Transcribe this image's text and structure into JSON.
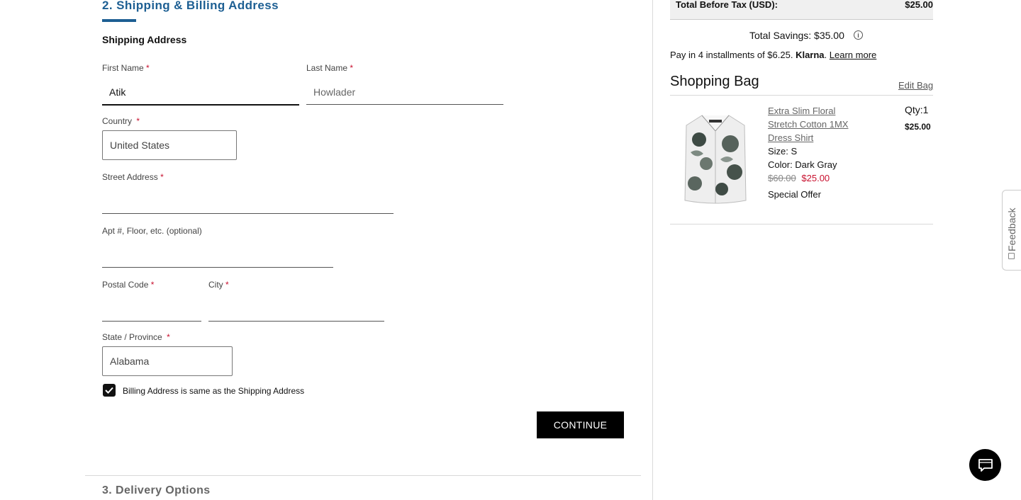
{
  "checkout": {
    "section_title": "2. Shipping & Billing Address",
    "shipping_subtitle": "Shipping Address",
    "next_section_title": "3. Delivery Options",
    "continue_label": "CONTINUE",
    "required_mark": "*"
  },
  "form": {
    "first_name": {
      "label": "First Name",
      "value": "Atik"
    },
    "last_name": {
      "label": "Last Name",
      "placeholder": "Howlader"
    },
    "country": {
      "label": "Country",
      "selected": "United States"
    },
    "street": {
      "label": "Street Address",
      "value": ""
    },
    "apt": {
      "label": "Apt #, Floor, etc. (optional)",
      "value": ""
    },
    "postal": {
      "label": "Postal Code",
      "value": ""
    },
    "city": {
      "label": "City",
      "value": ""
    },
    "state": {
      "label": "State / Province",
      "selected": "Alabama"
    },
    "billing_same": {
      "label": "Billing Address is same as the Shipping Address",
      "checked": true
    }
  },
  "summary": {
    "total_before_tax_label": "Total Before Tax (USD):",
    "total_before_tax_value": "$25.00",
    "total_savings": "Total Savings: $35.00",
    "klarna_prefix": "Pay in 4 installments of $6.25.",
    "klarna_brand": "Klarna",
    "klarna_suffix": ".",
    "learn_more": "Learn more"
  },
  "bag": {
    "title": "Shopping Bag",
    "edit_label": "Edit Bag",
    "items": [
      {
        "name": "Extra Slim Floral Stretch Cotton 1MX Dress Shirt",
        "size": "Size: S",
        "color": "Color: Dark Gray",
        "original_price": "$60.00",
        "sale_price": "$25.00",
        "offer": "Special Offer",
        "qty": "Qty:1",
        "price": "$25.00"
      }
    ]
  },
  "widgets": {
    "feedback_label": "Feedback"
  },
  "colors": {
    "accent_blue": "#1d5f93",
    "required_red": "#c8102e",
    "sale_red": "#c8102e",
    "button_black": "#000000"
  }
}
